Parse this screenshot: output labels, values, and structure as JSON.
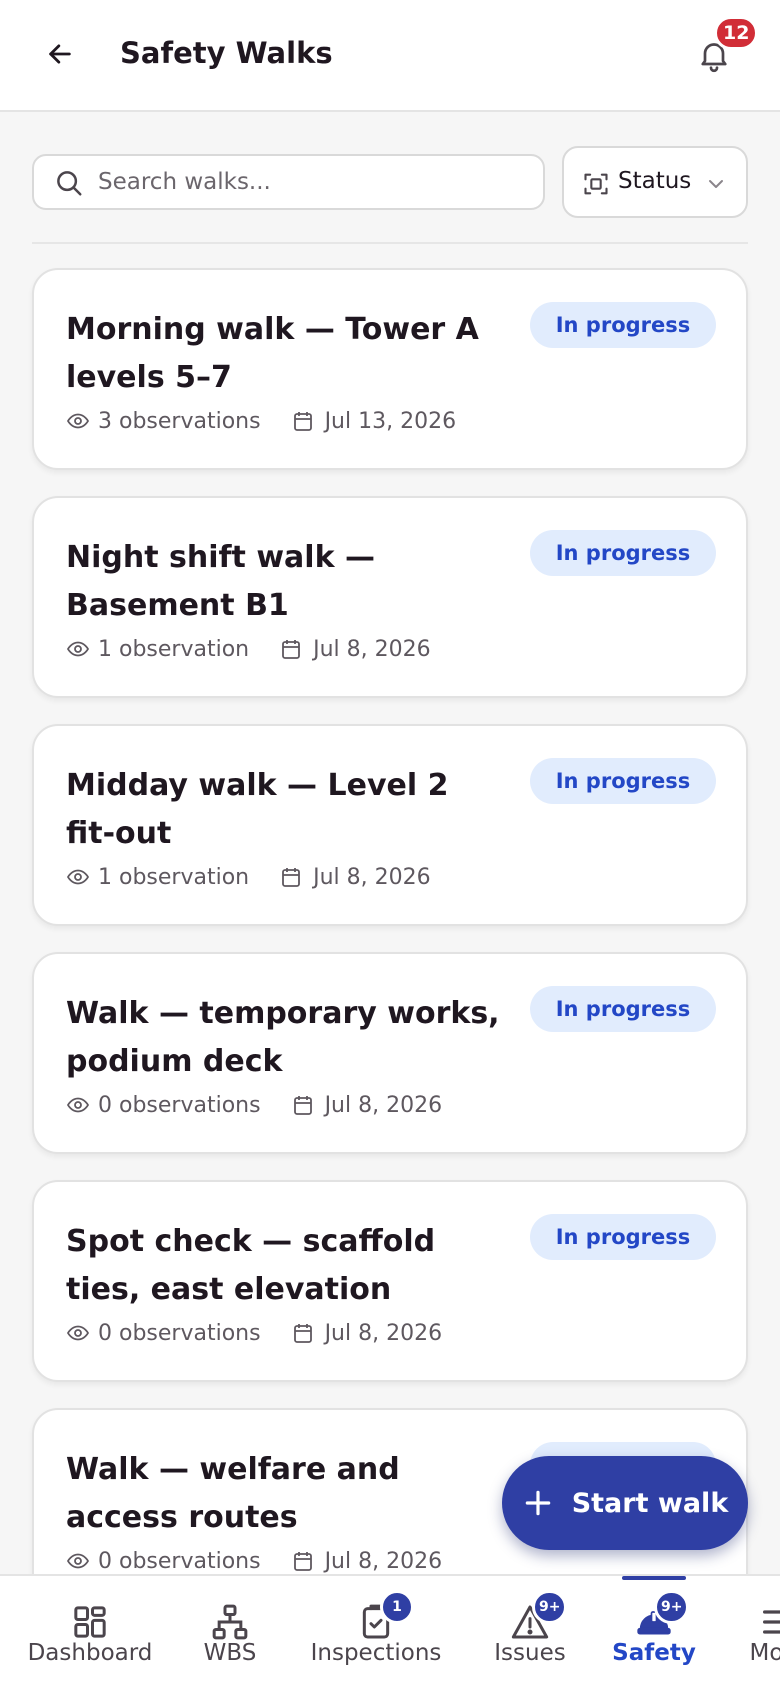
{
  "header": {
    "title": "Safety Walks",
    "notification_count": "12"
  },
  "search": {
    "placeholder": "Search walks..."
  },
  "filter": {
    "label": "Status"
  },
  "walks": [
    {
      "title": "Morning walk — Tower A levels 5–7",
      "status": "In progress",
      "observations": "3 observations",
      "date": "Jul 13, 2026"
    },
    {
      "title": "Night shift walk — Basement B1",
      "status": "In progress",
      "observations": "1 observation",
      "date": "Jul 8, 2026"
    },
    {
      "title": "Midday walk — Level 2 fit-out",
      "status": "In progress",
      "observations": "1 observation",
      "date": "Jul 8, 2026"
    },
    {
      "title": "Walk — temporary works, podium deck",
      "status": "In progress",
      "observations": "0 observations",
      "date": "Jul 8, 2026"
    },
    {
      "title": "Spot check — scaffold ties, east elevation",
      "status": "In progress",
      "observations": "0 observations",
      "date": "Jul 8, 2026"
    },
    {
      "title": "Walk — welfare and access routes",
      "status": "In progress",
      "observations": "0 observations",
      "date": "Jul 8, 2026"
    }
  ],
  "fab": {
    "label": "Start walk"
  },
  "nav": {
    "dashboard": "Dashboard",
    "wbs": "WBS",
    "inspections": "Inspections",
    "inspections_badge": "1",
    "issues": "Issues",
    "issues_badge": "9+",
    "safety": "Safety",
    "safety_badge": "9+",
    "more": "More"
  },
  "colors": {
    "accent": "#2f3fa4",
    "status_pill_bg": "#e1ecfd",
    "status_pill_text": "#2347c6",
    "notification_badge": "#d12d37"
  }
}
